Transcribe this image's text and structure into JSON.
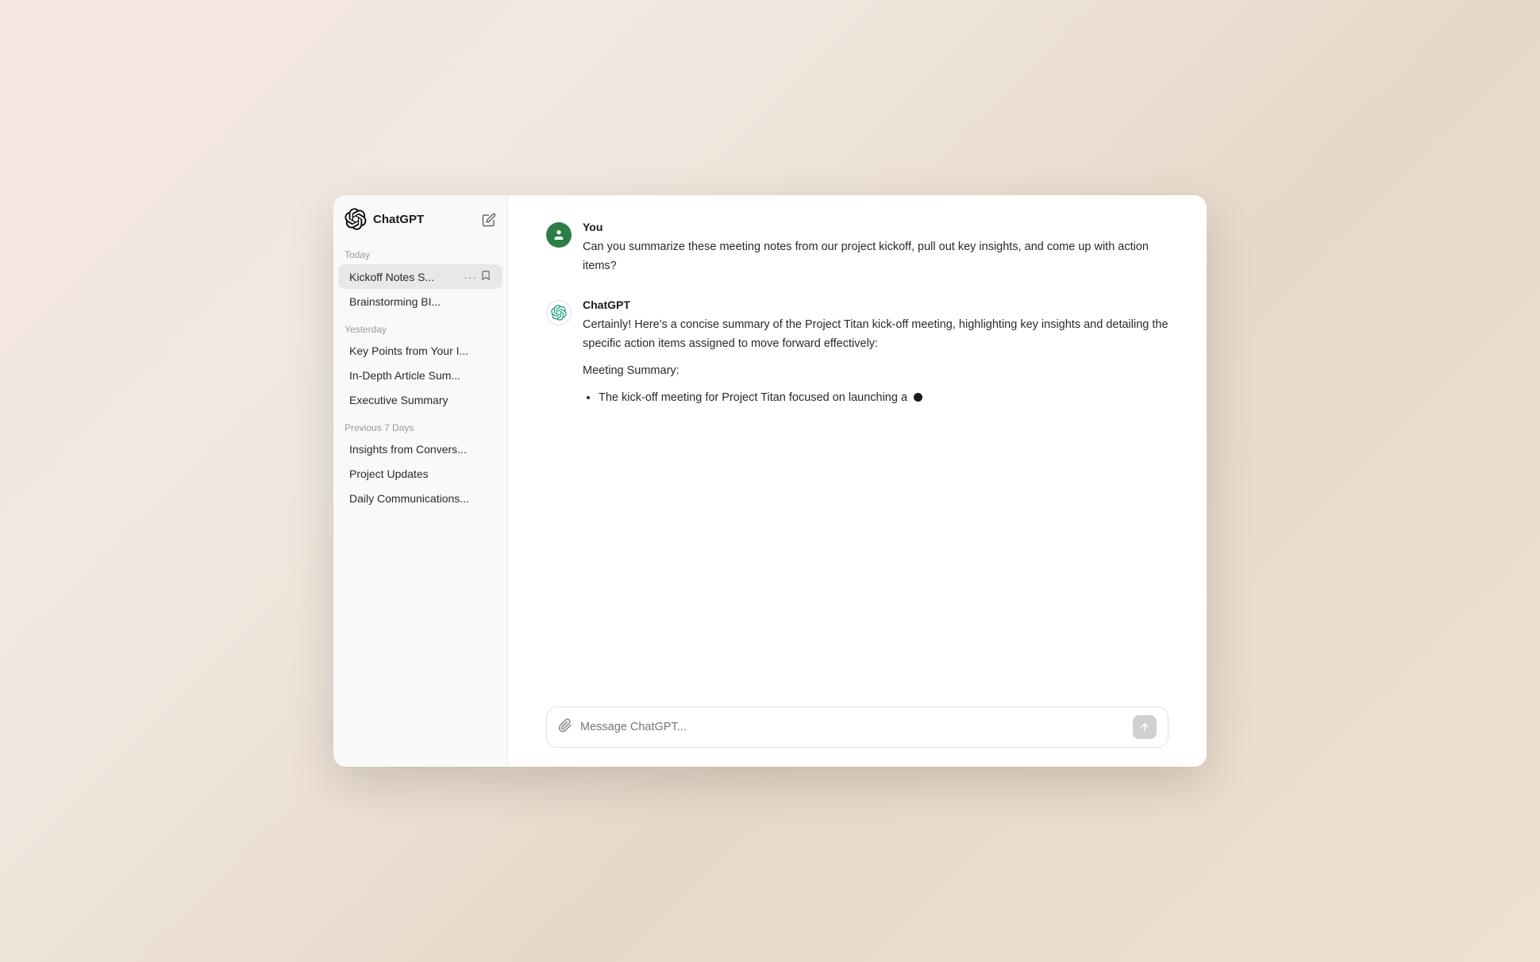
{
  "app": {
    "title": "ChatGPT",
    "new_chat_label": "New chat"
  },
  "sidebar": {
    "today_label": "Today",
    "yesterday_label": "Yesterday",
    "prev7_label": "Previous 7 Days",
    "today_items": [
      {
        "id": "kickoff",
        "label": "Kickoff Notes S...",
        "active": true
      },
      {
        "id": "brainstorming",
        "label": "Brainstorming BI...",
        "active": false
      }
    ],
    "yesterday_items": [
      {
        "id": "keypoints",
        "label": "Key Points from Your I...",
        "active": false
      },
      {
        "id": "indepth",
        "label": "In-Depth Article Sum...",
        "active": false
      },
      {
        "id": "executive",
        "label": "Executive Summary",
        "active": false
      }
    ],
    "prev7_items": [
      {
        "id": "insights",
        "label": "Insights from Convers...",
        "active": false
      },
      {
        "id": "project",
        "label": "Project Updates",
        "active": false
      },
      {
        "id": "daily",
        "label": "Daily Communications...",
        "active": false
      }
    ]
  },
  "chat": {
    "user_name": "You",
    "bot_name": "ChatGPT",
    "user_message": "Can you summarize these meeting notes from our project kickoff, pull out key insights, and come up with action items?",
    "bot_greeting": "Certainly! Here's a concise summary of the Project Titan kick-off meeting, highlighting key insights and detailing the specific action items assigned to move forward effectively:",
    "meeting_summary_label": "Meeting Summary:",
    "bullet_item": "The kick-off meeting for Project Titan focused on launching a"
  },
  "input": {
    "placeholder": "Message ChatGPT..."
  }
}
